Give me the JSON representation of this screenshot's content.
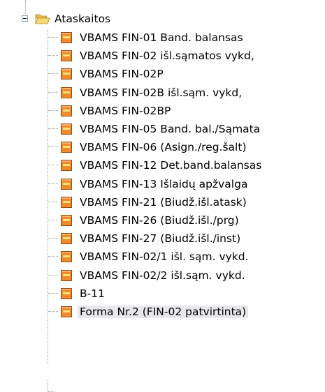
{
  "tree": {
    "folder": {
      "label": "Ataskaitos",
      "expander": "minus",
      "icon": "folder-open-icon"
    },
    "items": [
      {
        "label": "VBAMS FIN-01 Band. balansas",
        "icon": "report-icon"
      },
      {
        "label": "VBAMS FIN-02 išl.sąmatos vykd,",
        "icon": "report-icon"
      },
      {
        "label": "VBAMS FIN-02P",
        "icon": "report-icon"
      },
      {
        "label": "VBAMS FIN-02B išl.sąm. vykd,",
        "icon": "report-icon"
      },
      {
        "label": "VBAMS FIN-02BP",
        "icon": "report-icon"
      },
      {
        "label": "VBAMS FIN-05 Band. bal./Sąmata",
        "icon": "report-icon"
      },
      {
        "label": "VBAMS FIN-06 (Asign./reg.šalt)",
        "icon": "report-icon"
      },
      {
        "label": "VBAMS FIN-12 Det.band.balansas",
        "icon": "report-icon"
      },
      {
        "label": "VBAMS FIN-13 Išlaidų apžvalga",
        "icon": "report-icon"
      },
      {
        "label": "VBAMS FIN-21 (Biudž.išl.atask)",
        "icon": "report-icon"
      },
      {
        "label": "VBAMS FIN-26 (Biudž.išl./prg)",
        "icon": "report-icon"
      },
      {
        "label": "VBAMS FIN-27 (Biudž.išl./inst)",
        "icon": "report-icon"
      },
      {
        "label": "VBAMS FIN-02/1 išl. sąm. vykd.",
        "icon": "report-icon"
      },
      {
        "label": "VBAMS FIN-02/2 išl.sąm. vykd.",
        "icon": "report-icon"
      },
      {
        "label": "B-11",
        "icon": "report-icon"
      },
      {
        "label": "Forma Nr.2 (FIN-02 patvirtinta)",
        "icon": "report-icon",
        "selected": true
      }
    ]
  },
  "colors": {
    "folder": "#f5d26a",
    "report_fill": "#f08a2a",
    "report_band": "#f7e27a",
    "guide": "#a0a0a0",
    "selection": "#e8e8ec"
  }
}
